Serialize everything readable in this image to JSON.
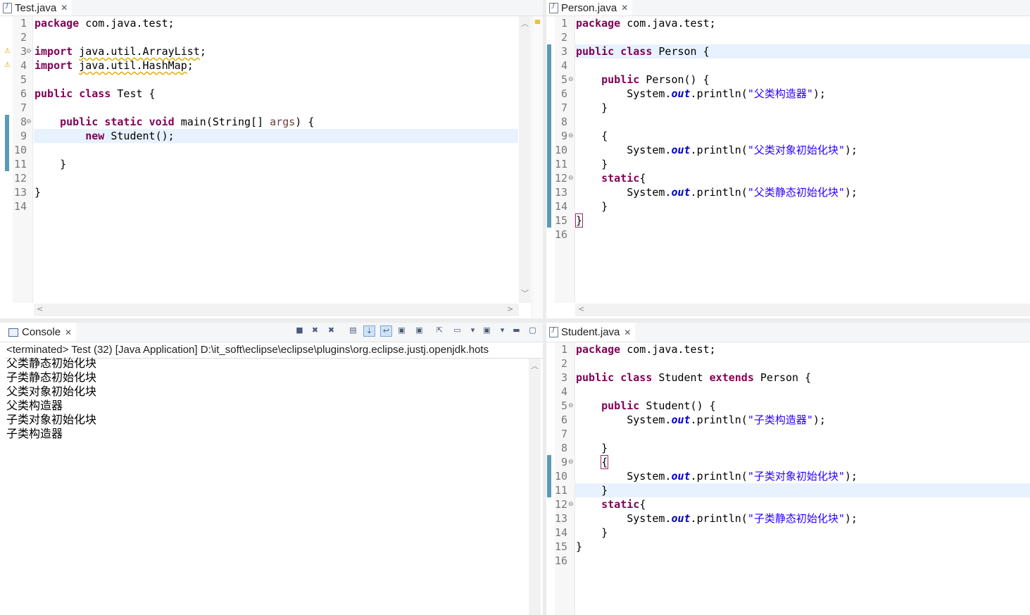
{
  "editors": {
    "test": {
      "tab": "Test.java",
      "lines": [
        [
          [
            "kw",
            "package"
          ],
          [
            "n",
            " com.java.test;"
          ]
        ],
        [],
        [
          [
            "kw",
            "import"
          ],
          [
            "n",
            " "
          ],
          [
            "imp",
            "java.util.ArrayList"
          ],
          [
            "n",
            ";"
          ]
        ],
        [
          [
            "kw",
            "import"
          ],
          [
            "n",
            " "
          ],
          [
            "imp",
            "java.util.HashMap"
          ],
          [
            "n",
            ";"
          ]
        ],
        [],
        [
          [
            "kw",
            "public"
          ],
          [
            "n",
            " "
          ],
          [
            "kw",
            "class"
          ],
          [
            "n",
            " Test {"
          ]
        ],
        [],
        [
          [
            "n",
            "    "
          ],
          [
            "kw",
            "public"
          ],
          [
            "n",
            " "
          ],
          [
            "kw",
            "static"
          ],
          [
            "n",
            " "
          ],
          [
            "kw",
            "void"
          ],
          [
            "n",
            " main(String[] "
          ],
          [
            "var",
            "args"
          ],
          [
            "n",
            ") {"
          ]
        ],
        [
          [
            "n",
            "        "
          ],
          [
            "kw",
            "new"
          ],
          [
            "n",
            " Student();"
          ]
        ],
        [],
        [
          [
            "n",
            "    }"
          ]
        ],
        [],
        [
          [
            "n",
            "}"
          ]
        ],
        []
      ]
    },
    "person": {
      "tab": "Person.java",
      "lines": [
        [
          [
            "kw",
            "package"
          ],
          [
            "n",
            " com.java.test;"
          ]
        ],
        [],
        [
          [
            "kw",
            "public"
          ],
          [
            "n",
            " "
          ],
          [
            "kw",
            "class"
          ],
          [
            "n",
            " Person {"
          ]
        ],
        [],
        [
          [
            "n",
            "    "
          ],
          [
            "kw",
            "public"
          ],
          [
            "n",
            " Person() {"
          ]
        ],
        [
          [
            "n",
            "        System."
          ],
          [
            "fld",
            "out"
          ],
          [
            "n",
            ".println("
          ],
          [
            "str",
            "\"父类构造器\""
          ],
          [
            "n",
            ");"
          ]
        ],
        [
          [
            "n",
            "    }"
          ]
        ],
        [],
        [
          [
            "n",
            "    {"
          ]
        ],
        [
          [
            "n",
            "        System."
          ],
          [
            "fld",
            "out"
          ],
          [
            "n",
            ".println("
          ],
          [
            "str",
            "\"父类对象初始化块\""
          ],
          [
            "n",
            ");"
          ]
        ],
        [
          [
            "n",
            "    }"
          ]
        ],
        [
          [
            "n",
            "    "
          ],
          [
            "kw",
            "static"
          ],
          [
            "n",
            "{"
          ]
        ],
        [
          [
            "n",
            "        System."
          ],
          [
            "fld",
            "out"
          ],
          [
            "n",
            ".println("
          ],
          [
            "str",
            "\"父类静态初始化块\""
          ],
          [
            "n",
            ");"
          ]
        ],
        [
          [
            "n",
            "    }"
          ]
        ],
        [
          [
            "brace",
            "}"
          ]
        ],
        []
      ]
    },
    "student": {
      "tab": "Student.java",
      "lines": [
        [
          [
            "kw",
            "package"
          ],
          [
            "n",
            " com.java.test;"
          ]
        ],
        [],
        [
          [
            "kw",
            "public"
          ],
          [
            "n",
            " "
          ],
          [
            "kw",
            "class"
          ],
          [
            "n",
            " Student "
          ],
          [
            "kw",
            "extends"
          ],
          [
            "n",
            " Person {"
          ]
        ],
        [],
        [
          [
            "n",
            "    "
          ],
          [
            "kw",
            "public"
          ],
          [
            "n",
            " Student() {"
          ]
        ],
        [
          [
            "n",
            "        System."
          ],
          [
            "fld",
            "out"
          ],
          [
            "n",
            ".println("
          ],
          [
            "str",
            "\"子类构造器\""
          ],
          [
            "n",
            ");"
          ]
        ],
        [],
        [
          [
            "n",
            "    }"
          ]
        ],
        [
          [
            "n",
            "    "
          ],
          [
            "brace",
            "{"
          ]
        ],
        [
          [
            "n",
            "        System."
          ],
          [
            "fld",
            "out"
          ],
          [
            "n",
            ".println("
          ],
          [
            "str",
            "\"子类对象初始化块\""
          ],
          [
            "n",
            ");"
          ]
        ],
        [
          [
            "n",
            "    }"
          ]
        ],
        [
          [
            "n",
            "    "
          ],
          [
            "kw",
            "static"
          ],
          [
            "n",
            "{"
          ]
        ],
        [
          [
            "n",
            "        System."
          ],
          [
            "fld",
            "out"
          ],
          [
            "n",
            ".println("
          ],
          [
            "str",
            "\"子类静态初始化块\""
          ],
          [
            "n",
            ");"
          ]
        ],
        [
          [
            "n",
            "    }"
          ]
        ],
        [
          [
            "n",
            "}"
          ]
        ],
        []
      ]
    }
  },
  "console": {
    "tab": "Console",
    "header": "<terminated> Test (32) [Java Application] D:\\it_soft\\eclipse\\eclipse\\plugins\\org.eclipse.justj.openjdk.hots",
    "output": [
      "父类静态初始化块",
      "子类静态初始化块",
      "父类对象初始化块",
      "父类构造器",
      "子类对象初始化块",
      "子类构造器"
    ],
    "toolbar_icons": [
      "stop-icon",
      "remove-launch-icon",
      "remove-all-icon",
      "clear-console-icon",
      "scroll-lock-icon",
      "word-wrap-icon",
      "show-on-output-icon",
      "show-on-error-icon",
      "pin-console-icon",
      "display-console-icon",
      "dropdown-icon",
      "open-console-icon",
      "dropdown-icon",
      "minimize-icon",
      "maximize-icon"
    ]
  },
  "colors": {
    "keyword": "#7f0055",
    "string": "#2a00ff",
    "field": "#0000c0",
    "current_line": "#e8f2fe"
  }
}
